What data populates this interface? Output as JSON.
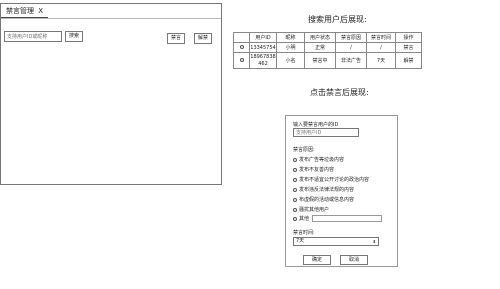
{
  "panel": {
    "tab_label": "禁言管理",
    "tab_close": "X",
    "search_placeholder": "支持用户ID或昵称",
    "search_button": "搜索",
    "mute_button": "禁言",
    "unmute_button": "解禁"
  },
  "search_result": {
    "heading": "搜索用户后展现:",
    "columns": [
      "",
      "用户ID",
      "昵称",
      "用户状态",
      "禁言原因",
      "禁言时间",
      "操作"
    ],
    "rows": [
      [
        "",
        "13345754",
        "小明",
        "正常",
        "/",
        "/",
        "禁言"
      ],
      [
        "",
        "18967838\n462",
        "小名",
        "禁言中",
        "非法广告",
        "7天",
        "解禁"
      ]
    ]
  },
  "dialog": {
    "heading": "点击禁言后展现:",
    "user_id_label": "输入要禁言用户的ID",
    "user_id_placeholder": "支持用户ID",
    "reason_label": "禁言原因:",
    "reasons": [
      "发布广告等垃圾内容",
      "发布不友善内容",
      "发布不适宜公开讨论的政治内容",
      "发布违反法律法规的内容",
      "布虚假的活动或信息内容",
      "骚扰其他用户",
      "其他"
    ],
    "time_label": "禁言时间:",
    "time_value": "7天",
    "ok_button": "确定",
    "cancel_button": "取消"
  }
}
